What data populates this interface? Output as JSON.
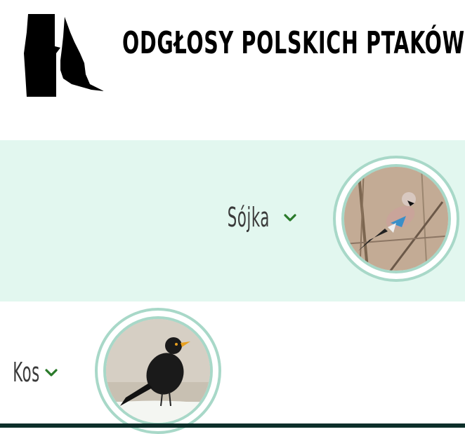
{
  "header": {
    "title": "ODGŁOSY POLSKICH PTAKÓW",
    "logo_icon": "nuthatch-silhouette-icon"
  },
  "birds": [
    {
      "name": "Sójka",
      "expand_icon": "chevron-down-icon",
      "photo": "jay-photo"
    },
    {
      "name": "Kos",
      "expand_icon": "chevron-down-icon",
      "photo": "blackbird-photo"
    }
  ],
  "colors": {
    "band": "#e2f7ef",
    "ring": "#a8d8c8",
    "chevron": "#2a7a2a",
    "footer": "#0d2f2a"
  }
}
